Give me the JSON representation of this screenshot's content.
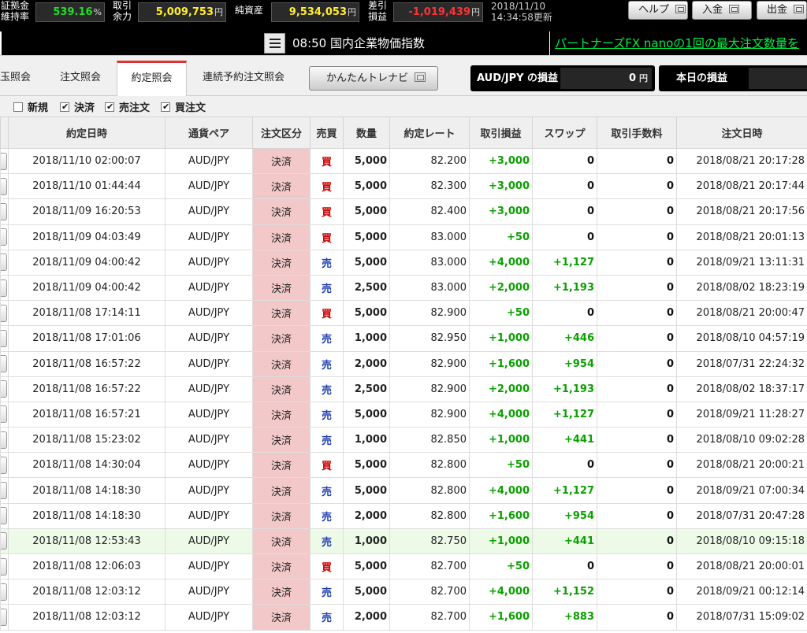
{
  "header": {
    "margin_ratio_label": "証拠金\n維持率",
    "margin_ratio_value": "539.16",
    "margin_ratio_unit": "%",
    "available_label": "取引\n余力",
    "available_value": "5,009,753",
    "net_assets_label": "純資産",
    "net_assets_value": "9,534,053",
    "pnl_label": "差引\n損益",
    "pnl_value": "-1,019,439",
    "currency_unit": "円",
    "date": "2018/11/10",
    "updated": "14:34:58更新",
    "help_label": "ヘルプ",
    "deposit_label": "入金",
    "withdraw_label": "出金",
    "colors": {
      "positive": "#22dd22",
      "negative": "#ff3333",
      "value_yellow": "#ffee33"
    }
  },
  "news": {
    "time_title": "08:50 国内企業物価指数",
    "ticker": "パートナーズFX nanoの1回の最大注文数量を"
  },
  "tabs": [
    {
      "label": "玉照会",
      "active": false
    },
    {
      "label": "注文照会",
      "active": false
    },
    {
      "label": "約定照会",
      "active": true
    },
    {
      "label": "連続予約注文照会",
      "active": false
    }
  ],
  "easy_button_label": "かんたんトレナビ",
  "pair_pnl": {
    "label": "AUD/JPY の損益",
    "value": "0",
    "unit": "円"
  },
  "today_pnl": {
    "label": "本日の損益",
    "value": ""
  },
  "filters": [
    {
      "label": "新規",
      "checked": false
    },
    {
      "label": "決済",
      "checked": true
    },
    {
      "label": "売注文",
      "checked": true
    },
    {
      "label": "買注文",
      "checked": true
    }
  ],
  "table": {
    "headers": [
      "",
      "約定日時",
      "通貨ペア",
      "注文区分",
      "売買",
      "数量",
      "約定レート",
      "取引損益",
      "スワップ",
      "取引手数料",
      "注文日時"
    ],
    "rows": [
      {
        "exec_time": "2018/11/10 02:00:07",
        "pair": "AUD/JPY",
        "kind": "決済",
        "side": "買",
        "qty": "5,000",
        "rate": "82.200",
        "pnl": "+3,000",
        "swap": "0",
        "fee": "0",
        "order_time": "2018/08/21 20:17:28"
      },
      {
        "exec_time": "2018/11/10 01:44:44",
        "pair": "AUD/JPY",
        "kind": "決済",
        "side": "買",
        "qty": "5,000",
        "rate": "82.300",
        "pnl": "+3,000",
        "swap": "0",
        "fee": "0",
        "order_time": "2018/08/21 20:17:44"
      },
      {
        "exec_time": "2018/11/09 16:20:53",
        "pair": "AUD/JPY",
        "kind": "決済",
        "side": "買",
        "qty": "5,000",
        "rate": "82.400",
        "pnl": "+3,000",
        "swap": "0",
        "fee": "0",
        "order_time": "2018/08/21 20:17:56"
      },
      {
        "exec_time": "2018/11/09 04:03:49",
        "pair": "AUD/JPY",
        "kind": "決済",
        "side": "買",
        "qty": "5,000",
        "rate": "83.000",
        "pnl": "+50",
        "swap": "0",
        "fee": "0",
        "order_time": "2018/08/21 20:01:13"
      },
      {
        "exec_time": "2018/11/09 04:00:42",
        "pair": "AUD/JPY",
        "kind": "決済",
        "side": "売",
        "qty": "5,000",
        "rate": "83.000",
        "pnl": "+4,000",
        "swap": "+1,127",
        "fee": "0",
        "order_time": "2018/09/21 13:11:31"
      },
      {
        "exec_time": "2018/11/09 04:00:42",
        "pair": "AUD/JPY",
        "kind": "決済",
        "side": "売",
        "qty": "2,500",
        "rate": "83.000",
        "pnl": "+2,000",
        "swap": "+1,193",
        "fee": "0",
        "order_time": "2018/08/02 18:23:19"
      },
      {
        "exec_time": "2018/11/08 17:14:11",
        "pair": "AUD/JPY",
        "kind": "決済",
        "side": "買",
        "qty": "5,000",
        "rate": "82.900",
        "pnl": "+50",
        "swap": "0",
        "fee": "0",
        "order_time": "2018/08/21 20:00:47"
      },
      {
        "exec_time": "2018/11/08 17:01:06",
        "pair": "AUD/JPY",
        "kind": "決済",
        "side": "売",
        "qty": "1,000",
        "rate": "82.950",
        "pnl": "+1,000",
        "swap": "+446",
        "fee": "0",
        "order_time": "2018/08/10 04:57:19"
      },
      {
        "exec_time": "2018/11/08 16:57:22",
        "pair": "AUD/JPY",
        "kind": "決済",
        "side": "売",
        "qty": "2,000",
        "rate": "82.900",
        "pnl": "+1,600",
        "swap": "+954",
        "fee": "0",
        "order_time": "2018/07/31 22:24:32"
      },
      {
        "exec_time": "2018/11/08 16:57:22",
        "pair": "AUD/JPY",
        "kind": "決済",
        "side": "売",
        "qty": "2,500",
        "rate": "82.900",
        "pnl": "+2,000",
        "swap": "+1,193",
        "fee": "0",
        "order_time": "2018/08/02 18:37:17"
      },
      {
        "exec_time": "2018/11/08 16:57:21",
        "pair": "AUD/JPY",
        "kind": "決済",
        "side": "売",
        "qty": "5,000",
        "rate": "82.900",
        "pnl": "+4,000",
        "swap": "+1,127",
        "fee": "0",
        "order_time": "2018/09/21 11:28:27"
      },
      {
        "exec_time": "2018/11/08 15:23:02",
        "pair": "AUD/JPY",
        "kind": "決済",
        "side": "売",
        "qty": "1,000",
        "rate": "82.850",
        "pnl": "+1,000",
        "swap": "+441",
        "fee": "0",
        "order_time": "2018/08/10 09:02:28"
      },
      {
        "exec_time": "2018/11/08 14:30:04",
        "pair": "AUD/JPY",
        "kind": "決済",
        "side": "買",
        "qty": "5,000",
        "rate": "82.800",
        "pnl": "+50",
        "swap": "0",
        "fee": "0",
        "order_time": "2018/08/21 20:00:21"
      },
      {
        "exec_time": "2018/11/08 14:18:30",
        "pair": "AUD/JPY",
        "kind": "決済",
        "side": "売",
        "qty": "5,000",
        "rate": "82.800",
        "pnl": "+4,000",
        "swap": "+1,127",
        "fee": "0",
        "order_time": "2018/09/21 07:00:34"
      },
      {
        "exec_time": "2018/11/08 14:18:30",
        "pair": "AUD/JPY",
        "kind": "決済",
        "side": "売",
        "qty": "2,000",
        "rate": "82.800",
        "pnl": "+1,600",
        "swap": "+954",
        "fee": "0",
        "order_time": "2018/07/31 20:47:28"
      },
      {
        "exec_time": "2018/11/08 12:53:43",
        "pair": "AUD/JPY",
        "kind": "決済",
        "side": "売",
        "qty": "1,000",
        "rate": "82.750",
        "pnl": "+1,000",
        "swap": "+441",
        "fee": "0",
        "order_time": "2018/08/10 09:15:18",
        "highlight": true
      },
      {
        "exec_time": "2018/11/08 12:06:03",
        "pair": "AUD/JPY",
        "kind": "決済",
        "side": "買",
        "qty": "5,000",
        "rate": "82.700",
        "pnl": "+50",
        "swap": "0",
        "fee": "0",
        "order_time": "2018/08/21 20:00:01"
      },
      {
        "exec_time": "2018/11/08 12:03:12",
        "pair": "AUD/JPY",
        "kind": "決済",
        "side": "売",
        "qty": "5,000",
        "rate": "82.700",
        "pnl": "+4,000",
        "swap": "+1,152",
        "fee": "0",
        "order_time": "2018/09/21 00:12:14"
      },
      {
        "exec_time": "2018/11/08 12:03:12",
        "pair": "AUD/JPY",
        "kind": "決済",
        "side": "売",
        "qty": "2,000",
        "rate": "82.700",
        "pnl": "+1,600",
        "swap": "+883",
        "fee": "0",
        "order_time": "2018/07/31 15:09:02"
      }
    ]
  }
}
